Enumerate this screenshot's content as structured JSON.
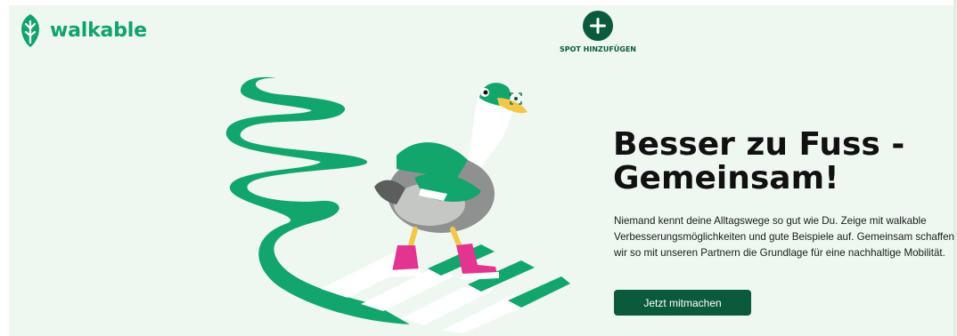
{
  "header": {
    "brand": "walkable",
    "add_spot_label": "SPOT HINZUFÜGEN"
  },
  "hero": {
    "title_line1": "Besser zu Fuss -",
    "title_line2": "Gemeinsam!",
    "description": "Niemand kennt deine Alltagswege so gut wie Du. Zeige mit walkable Verbesserungsmöglichkeiten und gute Beispiele auf. Gemeinsam schaffen wir so mit unseren Partnern die Grundlage für eine nachhaltige Mobilität.",
    "cta_label": "Jetzt mitmachen"
  },
  "colors": {
    "brand_green": "#11a36b",
    "dark_green": "#0b5a3d",
    "background": "#eef8f1"
  },
  "icons": [
    "walkable-logo-icon",
    "plus-icon",
    "duck-illustration",
    "focus-icon"
  ]
}
